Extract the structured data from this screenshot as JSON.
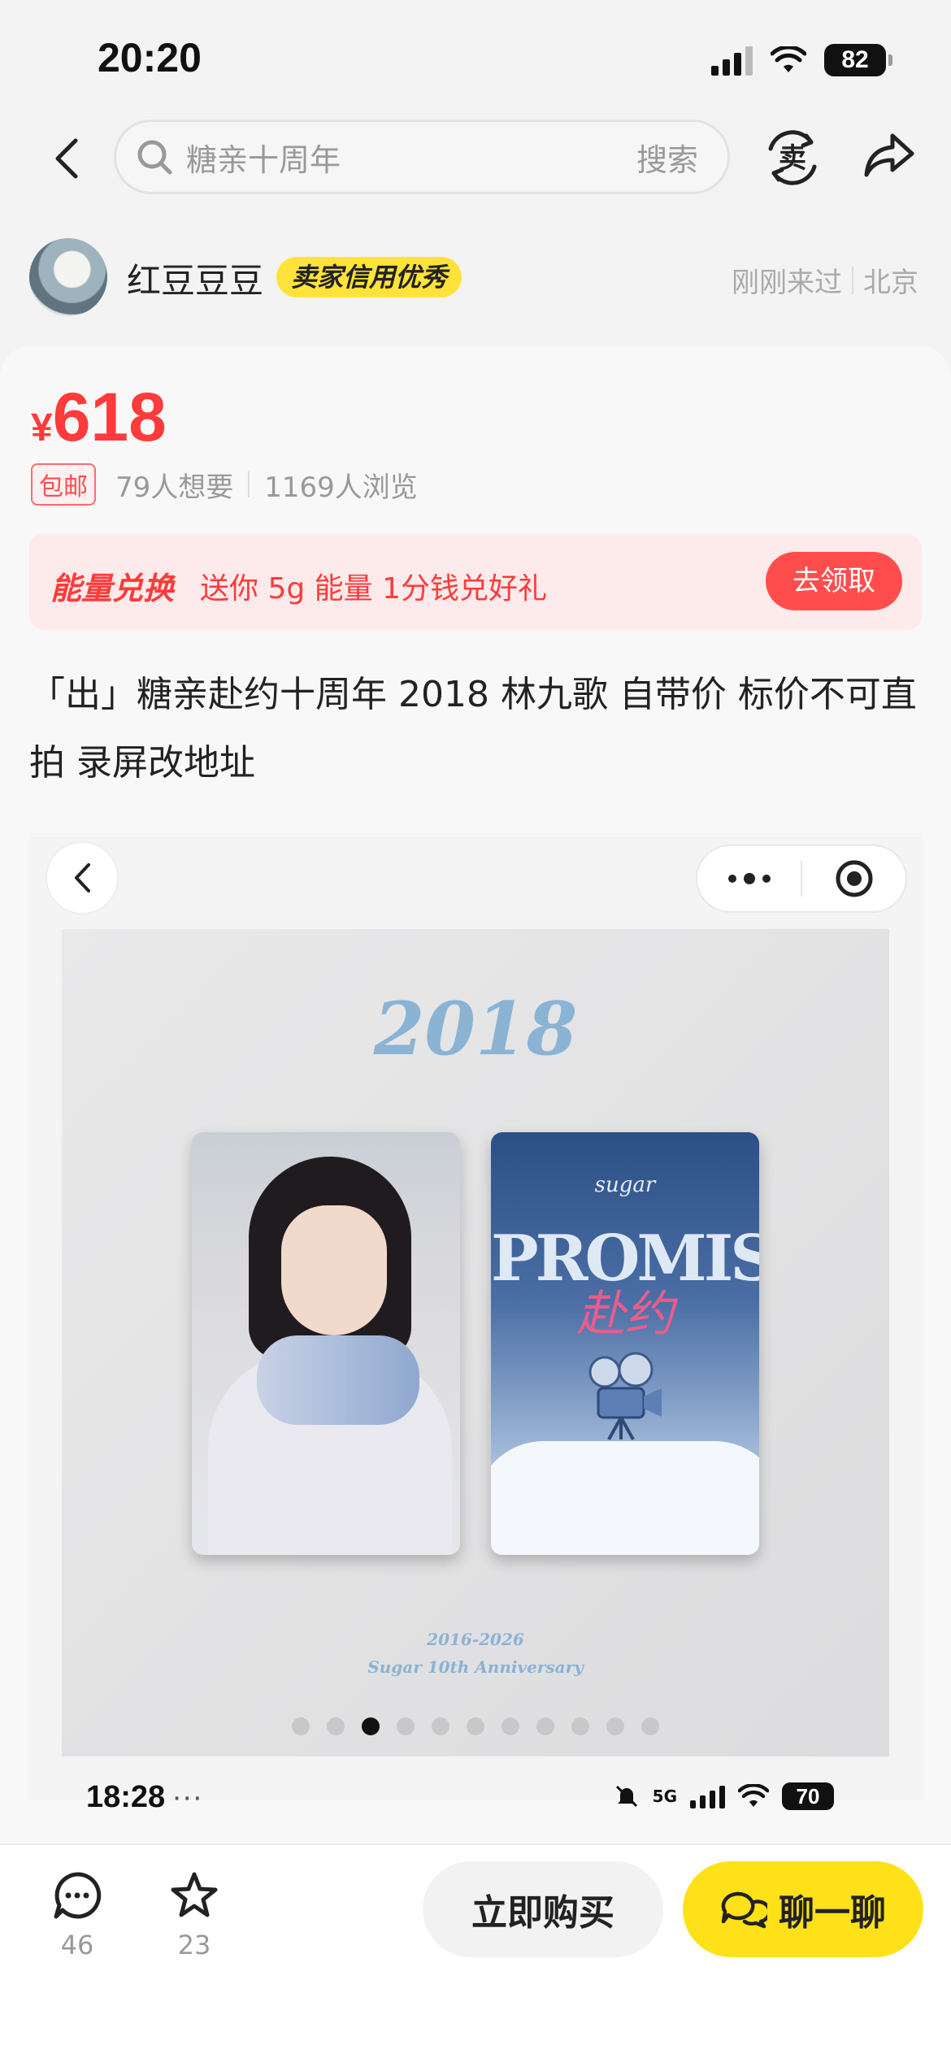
{
  "status_bar": {
    "time": "20:20",
    "battery": "82"
  },
  "nav": {
    "search_placeholder": "糖亲十周年",
    "search_button": "搜索",
    "sell_icon_label": "卖"
  },
  "seller": {
    "name": "红豆豆豆",
    "credit_badge": "卖家信用优秀",
    "last_seen": "刚刚来过",
    "location": "北京"
  },
  "listing": {
    "currency": "¥",
    "price": "618",
    "free_shipping": "包邮",
    "wants": "79人想要",
    "views": "1169人浏览",
    "title": "「出」糖亲赴约十周年 2018 林九歌 自带价 标价不可直拍  录屏改地址"
  },
  "energy_banner": {
    "title": "能量兑换",
    "description": "送你 5g 能量 1分钱兑好礼",
    "button": "去领取"
  },
  "poster": {
    "year": "2018",
    "card_sub": "sugar",
    "card_title": "PROMISE",
    "card_cn": "赴约",
    "footer_years": "2016-2026",
    "footer_text": "Sugar 10th Anniversary",
    "dots_total": 11,
    "dots_active_index": 2
  },
  "inner_status": {
    "time": "18:28",
    "extra": "···",
    "network": "5G",
    "battery": "70"
  },
  "bottom_bar": {
    "comments_count": "46",
    "favorites_count": "23",
    "buy_button": "立即购买",
    "chat_button": "聊一聊"
  },
  "colors": {
    "price_red": "#ff3b3b",
    "brand_yellow": "#ffe119",
    "badge_yellow": "#ffe33a",
    "energy_bg": "#fdeaea"
  }
}
